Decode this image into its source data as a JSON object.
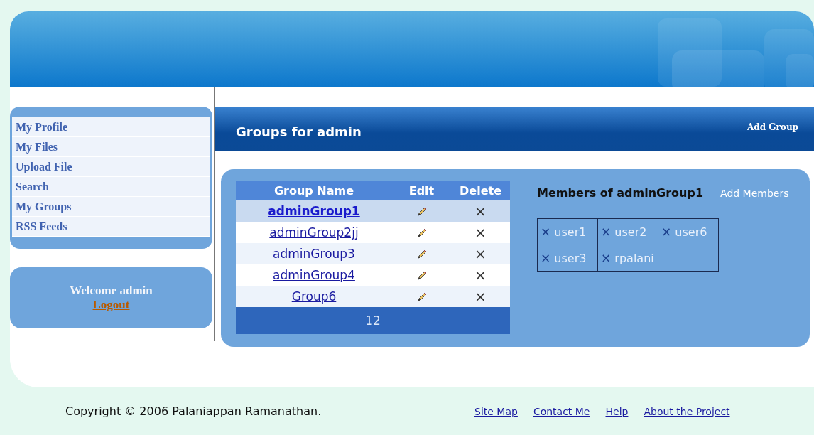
{
  "sidebar": {
    "items": [
      {
        "label": "My Profile"
      },
      {
        "label": "My Files"
      },
      {
        "label": "Upload File"
      },
      {
        "label": "Search"
      },
      {
        "label": "My Groups"
      },
      {
        "label": "RSS Feeds"
      }
    ],
    "welcome": "Welcome admin",
    "logout": "Logout"
  },
  "title_bar": {
    "title": "Groups for admin",
    "action": "Add Group"
  },
  "groups_table": {
    "columns": [
      "Group Name",
      "Edit",
      "Delete"
    ],
    "rows": [
      {
        "name": "adminGroup1",
        "selected": true
      },
      {
        "name": "adminGroup2jj",
        "selected": false
      },
      {
        "name": "adminGroup3",
        "selected": false
      },
      {
        "name": "adminGroup4",
        "selected": false
      },
      {
        "name": "Group6",
        "selected": false
      }
    ],
    "pages": [
      {
        "label": "1",
        "selected": true
      },
      {
        "label": "2",
        "selected": false
      }
    ]
  },
  "members": {
    "title": "Members of adminGroup1",
    "action": "Add Members",
    "users": [
      "user1",
      "user2",
      "user6",
      "user3",
      "rpalani"
    ],
    "remove_glyph": "×"
  },
  "footer": {
    "copyright": "Copyright © 2006 Palaniappan Ramanathan.",
    "links": [
      "Site Map",
      "Contact Me",
      "Help",
      "About the Project"
    ]
  }
}
